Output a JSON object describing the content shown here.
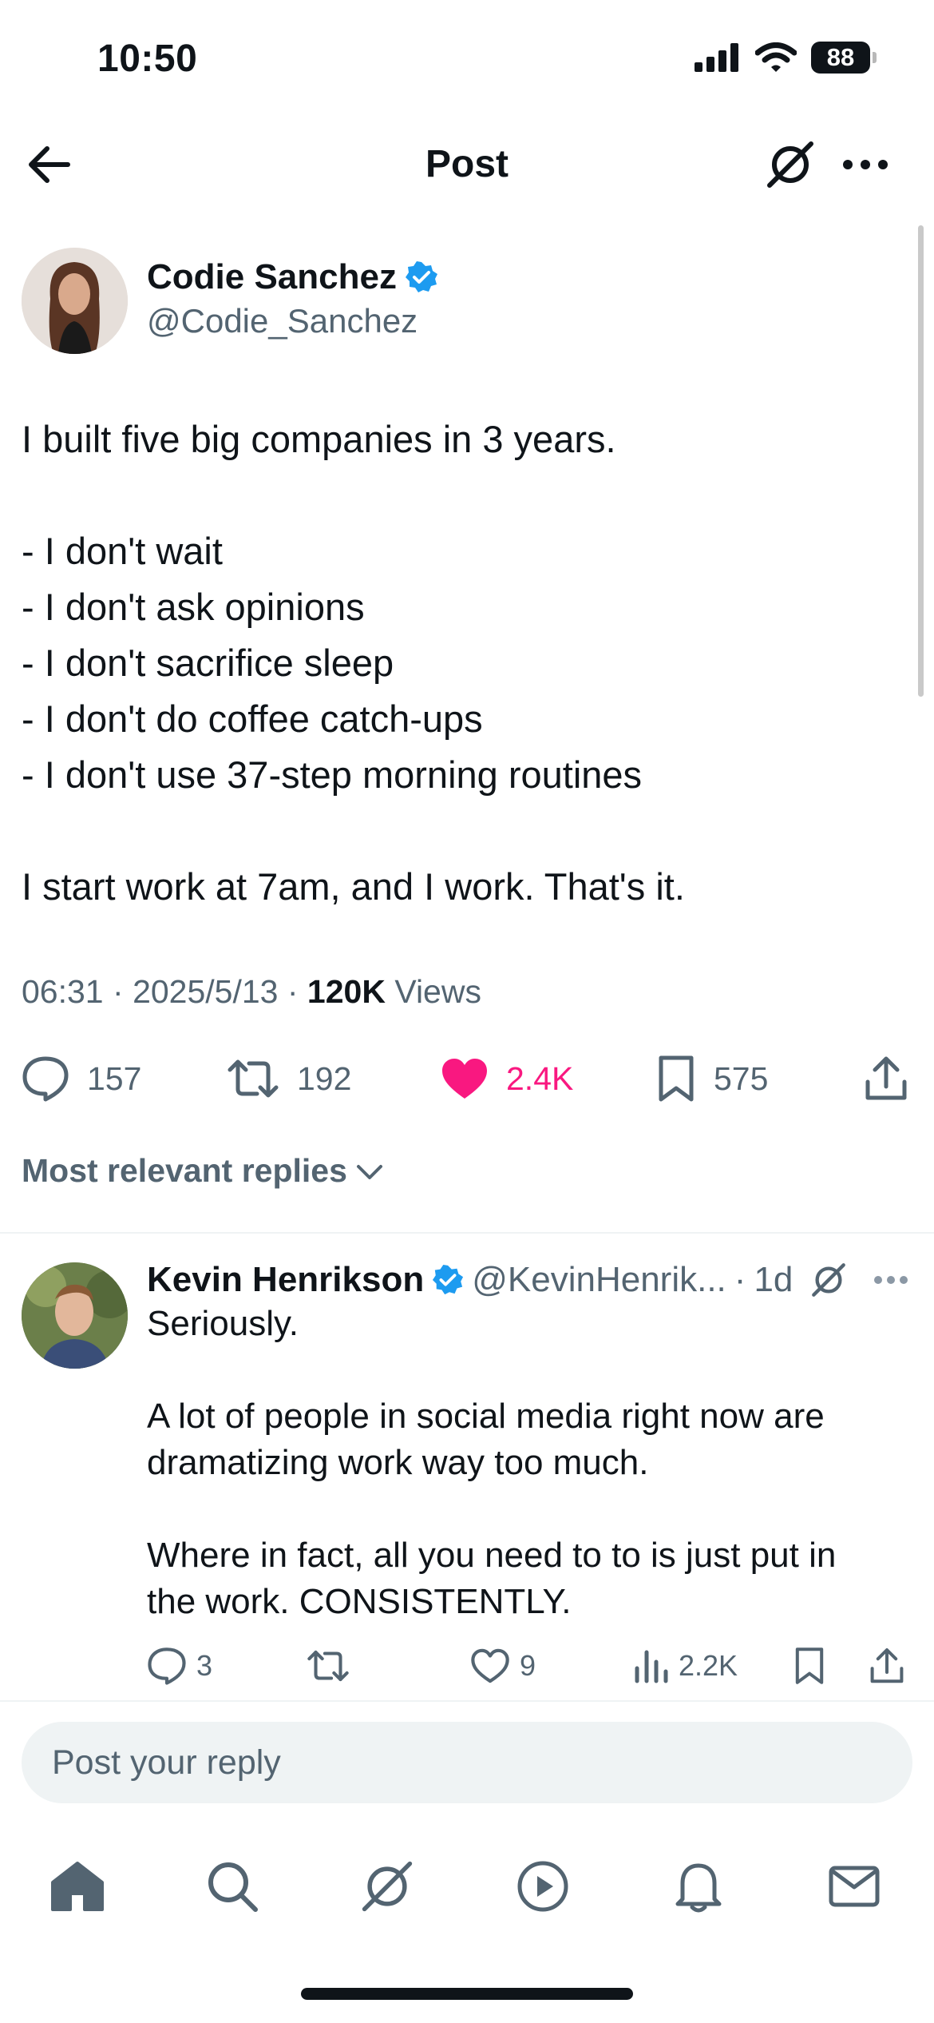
{
  "status_bar": {
    "time": "10:50",
    "battery": "88"
  },
  "header": {
    "title": "Post"
  },
  "post": {
    "author_name": "Codie Sanchez",
    "author_handle": "@Codie_Sanchez",
    "text_lines": [
      "I built five big companies in 3 years.",
      "",
      "- I don't wait",
      "- I don't ask opinions",
      "- I don't sacrifice sleep",
      "- I don't do coffee catch-ups",
      "- I don't use 37-step morning routines",
      "",
      "I start work at 7am, and I work. That's it."
    ],
    "time": "06:31",
    "date": "2025/5/13",
    "views_count": "120K",
    "views_label": "Views",
    "replies": "157",
    "reposts": "192",
    "likes": "2.4K",
    "bookmarks": "575"
  },
  "sort": {
    "label": "Most relevant replies"
  },
  "reply": {
    "author_name": "Kevin Henrikson",
    "author_handle": "@KevinHenrik...",
    "age": "1d",
    "text_lines": [
      "Seriously.",
      "",
      "A lot of people in social media right now are",
      "dramatizing work way too much.",
      "",
      "Where in fact, all you need to to is just put in",
      "the work. CONSISTENTLY."
    ],
    "replies": "3",
    "likes": "9",
    "views": "2.2K"
  },
  "composer": {
    "placeholder": "Post your reply"
  },
  "colors": {
    "like_pink": "#f91880",
    "verified_blue": "#1d9bf0",
    "muted_text": "#536471"
  }
}
